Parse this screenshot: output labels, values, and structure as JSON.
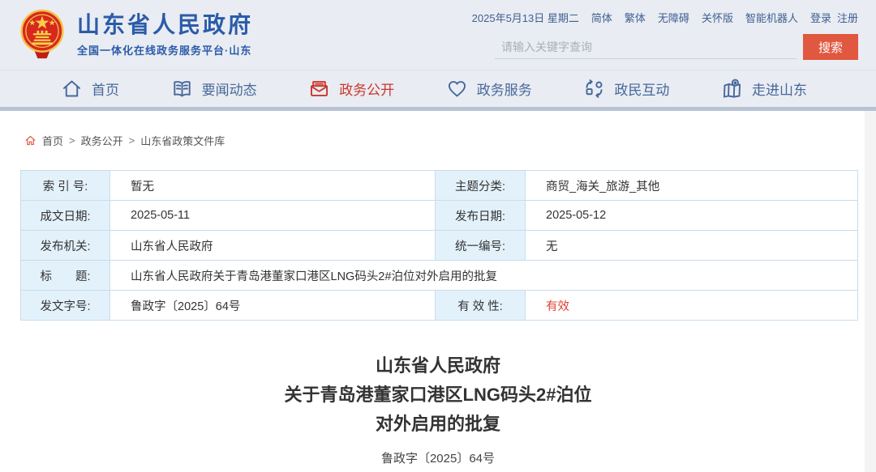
{
  "header": {
    "site_name": "山东省人民政府",
    "site_subtitle": "全国一体化在线政务服务平台·山东",
    "date": "2025年5月13日 星期二",
    "top_links": [
      "简体",
      "繁体",
      "无障碍",
      "关怀版",
      "智能机器人",
      "登录",
      "注册"
    ],
    "search": {
      "placeholder": "请输入关键字查询",
      "button_label": "搜索",
      "button_color": "#e0583f"
    }
  },
  "nav": {
    "items": [
      {
        "label": "首页",
        "icon": "home-icon",
        "active": false
      },
      {
        "label": "要闻动态",
        "icon": "book-icon",
        "active": false
      },
      {
        "label": "政务公开",
        "icon": "mail-icon",
        "active": true
      },
      {
        "label": "政务服务",
        "icon": "heart-icon",
        "active": false
      },
      {
        "label": "政民互动",
        "icon": "interaction-icon",
        "active": false
      },
      {
        "label": "走进山东",
        "icon": "map-icon",
        "active": false
      }
    ],
    "active_color": "#c9372c",
    "link_color": "#47689b"
  },
  "breadcrumb": {
    "separator": ">",
    "items": [
      "首页",
      "政务公开",
      "山东省政策文件库"
    ]
  },
  "doc_info": {
    "index_label": "索 引 号:",
    "index_value": "暂无",
    "topic_label": "主题分类:",
    "topic_value": "商贸_海关_旅游_其他",
    "written_date_label": "成文日期:",
    "written_date_value": "2025-05-11",
    "publish_date_label": "发布日期:",
    "publish_date_value": "2025-05-12",
    "publisher_label": "发布机关:",
    "publisher_value": "山东省人民政府",
    "unified_no_label": "统一编号:",
    "unified_no_value": "无",
    "title_label": "标　　题:",
    "title_value": "山东省人民政府关于青岛港董家口港区LNG码头2#泊位对外启用的批复",
    "doc_no_label": "发文字号:",
    "doc_no_value": "鲁政字〔2025〕64号",
    "validity_label": "有 效 性:",
    "validity_value": "有效",
    "validity_color": "#e34234"
  },
  "document": {
    "title_lines": [
      "山东省人民政府",
      "关于青岛港董家口港区LNG码头2#泊位",
      "对外启用的批复"
    ],
    "doc_number": "鲁政字〔2025〕64号"
  }
}
